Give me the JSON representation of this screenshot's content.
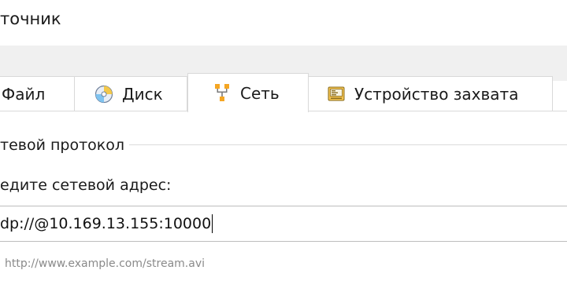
{
  "window": {
    "title": "точник"
  },
  "tabs": [
    {
      "label": "Файл",
      "icon": "none",
      "active": false
    },
    {
      "label": "Диск",
      "icon": "disc-icon",
      "active": false
    },
    {
      "label": "Сеть",
      "icon": "network-icon",
      "active": true
    },
    {
      "label": "Устройство захвата",
      "icon": "capture-device-icon",
      "active": false
    }
  ],
  "network": {
    "group_label": "тевой протокол",
    "address_label": "едите сетевой адрес:",
    "address_value": "dp://@10.169.13.155:10000",
    "address_hint": "http://www.example.com/stream.avi"
  },
  "colors": {
    "tab_bar_bg": "#f0f0f0",
    "border": "#d9d9d9",
    "hint_text": "#8a8a8a",
    "network_icon_orange": "#f5a623"
  }
}
